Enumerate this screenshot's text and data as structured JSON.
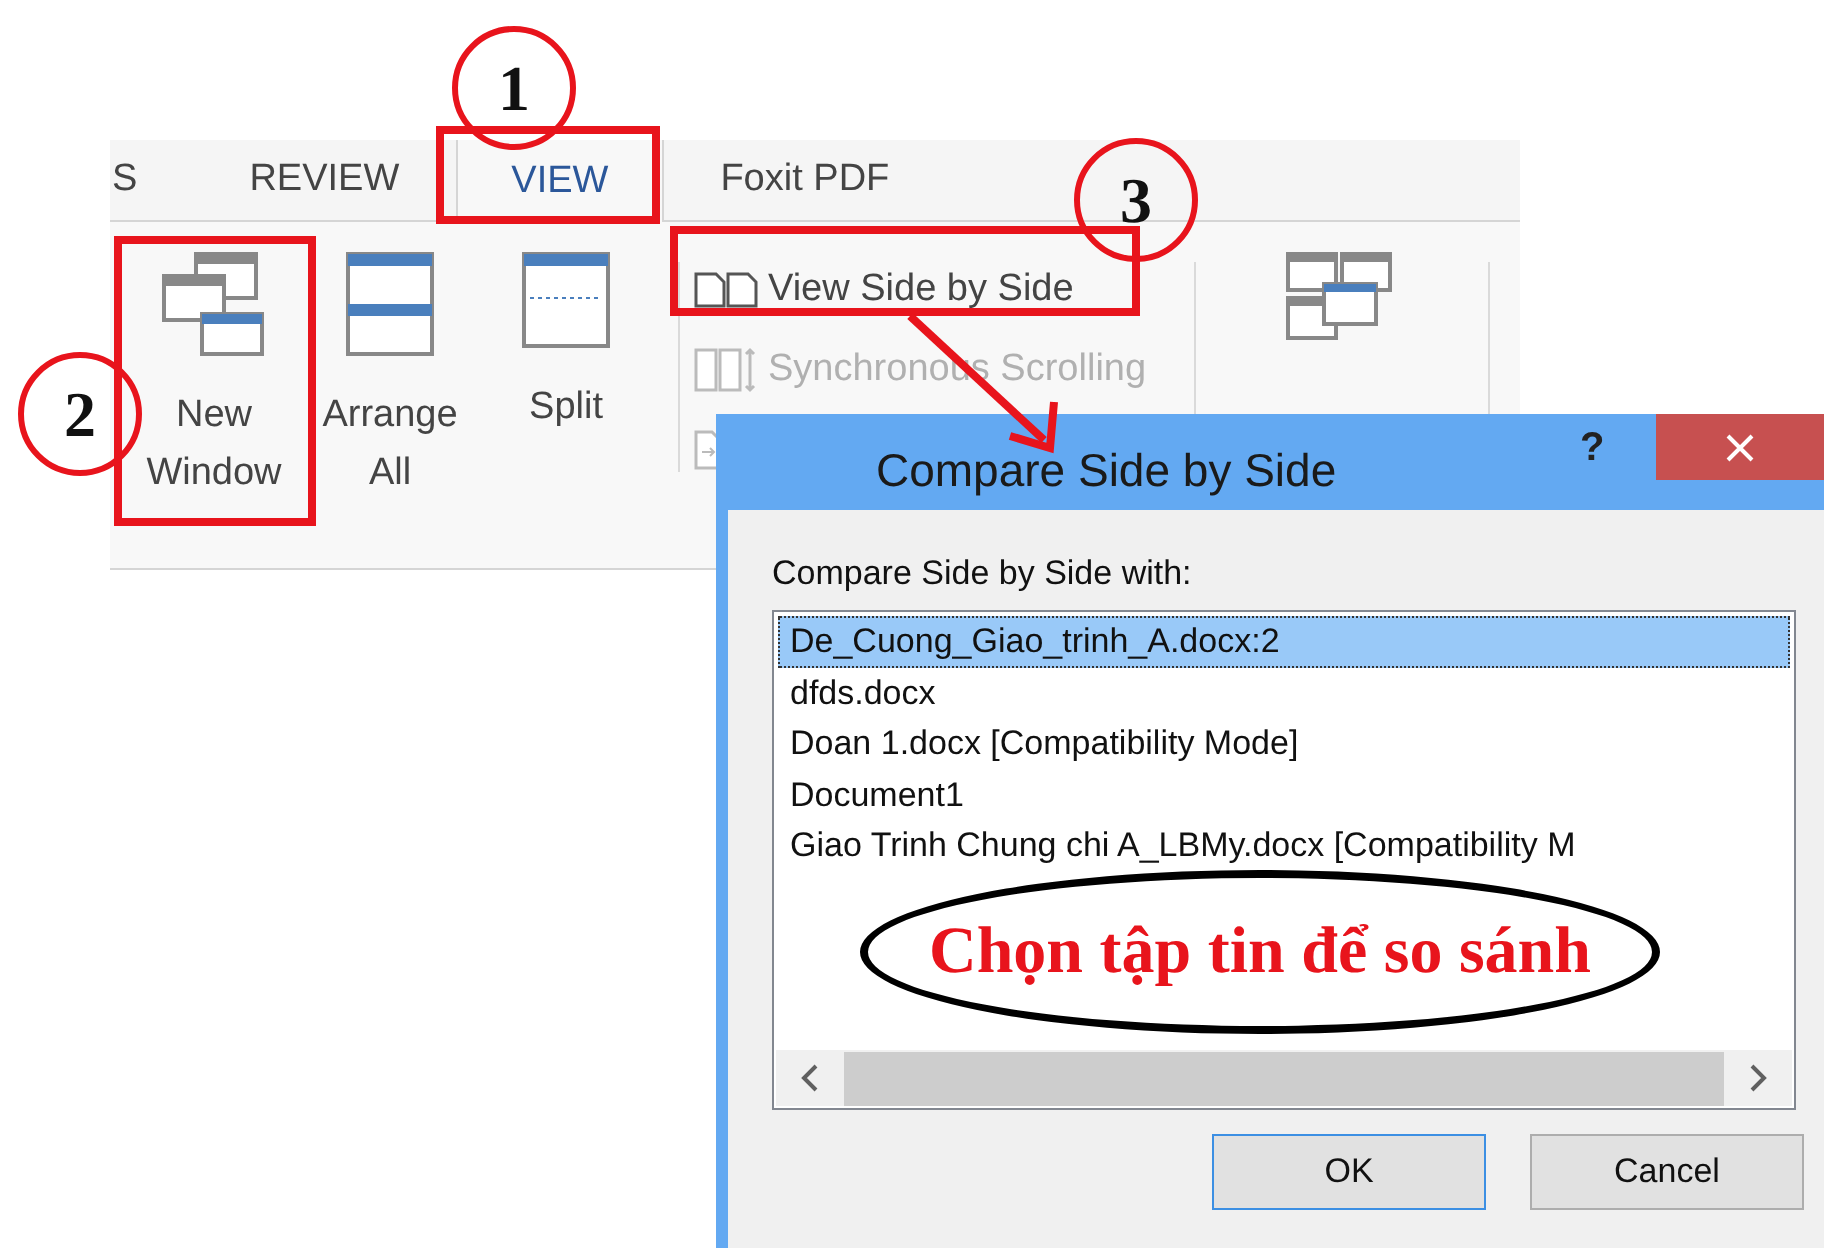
{
  "ribbon": {
    "tabs": [
      {
        "label": "S",
        "selected": false
      },
      {
        "label": "REVIEW",
        "selected": false
      },
      {
        "label": "VIEW",
        "selected": true
      },
      {
        "label": "Foxit PDF",
        "selected": false
      }
    ],
    "large_buttons": [
      {
        "label": "New Window",
        "kind": "new-window"
      },
      {
        "label": "Arrange All",
        "kind": "arrange-all"
      },
      {
        "label": "Split",
        "kind": "split"
      }
    ],
    "small_buttons": [
      {
        "label": "View Side by Side",
        "kind": "side-by-side",
        "disabled": false
      },
      {
        "label": "Synchronous Scrolling",
        "kind": "sync-scroll",
        "disabled": true
      }
    ]
  },
  "dialog": {
    "title": "Compare Side by Side",
    "help": "?",
    "list_label": "Compare Side by Side with:",
    "documents": [
      {
        "name": "De_Cuong_Giao_trinh_A.docx:2",
        "selected": true
      },
      {
        "name": "dfds.docx",
        "selected": false
      },
      {
        "name": "Doan 1.docx [Compatibility Mode]",
        "selected": false
      },
      {
        "name": "Document1",
        "selected": false
      },
      {
        "name": "Giao Trinh Chung chi A_LBMy.docx [Compatibility M",
        "selected": false
      }
    ],
    "buttons": [
      {
        "label": "OK",
        "default": true
      },
      {
        "label": "Cancel",
        "default": false
      }
    ]
  },
  "annotations": {
    "markers": [
      {
        "number": "1"
      },
      {
        "number": "2"
      },
      {
        "number": "3"
      }
    ],
    "note": "Chọn tập tin để so sánh"
  }
}
